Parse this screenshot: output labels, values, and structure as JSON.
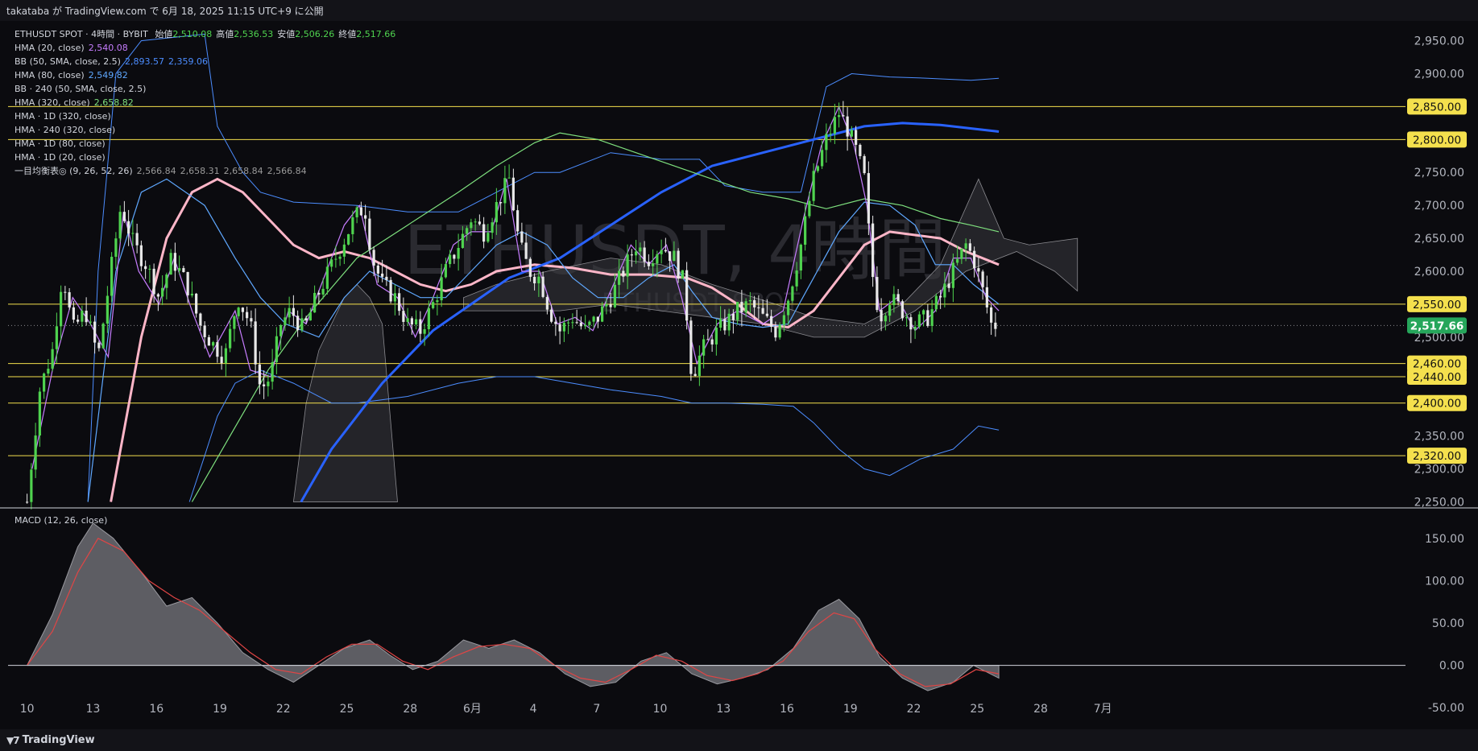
{
  "header": {
    "publish_text": "takataba が TradingView.com で 6月 18, 2025 11:15 UTC+9 に公開"
  },
  "watermark": {
    "main": "ETHUSDT, 4時間",
    "sub": "ETHUSDT SPOT"
  },
  "legend": {
    "symbol": "ETHUSDT SPOT · 4時間 · BYBIT",
    "ohlc": [
      {
        "label": "始値",
        "value": "2,510.08"
      },
      {
        "label": "高値",
        "value": "2,536.53"
      },
      {
        "label": "安値",
        "value": "2,506.26"
      },
      {
        "label": "終値",
        "value": "2,517.66"
      }
    ],
    "indicators": [
      {
        "name": "HMA (20, close)",
        "values": [
          "2,540.08"
        ],
        "color": "#c77dff"
      },
      {
        "name": "BB (50, SMA, close, 2.5)",
        "values": [
          "2,893.57",
          "2,359.06"
        ],
        "color": "#4c8dff"
      },
      {
        "name": "HMA (80, close)",
        "values": [
          "2,549.82"
        ],
        "color": "#5fa8ff"
      },
      {
        "name": "BB · 240 (50, SMA, close, 2.5)",
        "values": [],
        "color": "#d1d4dc"
      },
      {
        "name": "HMA (320, close)",
        "values": [
          "2,658.82"
        ],
        "color": "#7ee07e"
      },
      {
        "name": "HMA · 1D (320, close)",
        "values": [],
        "color": "#d1d4dc"
      },
      {
        "name": "HMA · 240 (320, close)",
        "values": [],
        "color": "#d1d4dc"
      },
      {
        "name": "HMA · 1D (80, close)",
        "values": [],
        "color": "#d1d4dc"
      },
      {
        "name": "HMA · 1D (20, close)",
        "values": [],
        "color": "#d1d4dc"
      },
      {
        "name": "一目均衡表◎ (9, 26, 52, 26)",
        "values": [
          "2,566.84",
          "2,658.31",
          "2,658.84",
          "2,566.84"
        ],
        "color": "#9a9a9a"
      }
    ]
  },
  "macd_label": "MACD (12, 26, close)",
  "footer": {
    "brand": "TradingView"
  },
  "colors": {
    "up": "#4fd34f",
    "down": "#e8e8e8",
    "hma20": "#c77dff",
    "hma80": "#5fa8ff",
    "hma320": "#7ee07e",
    "pink": "#ffb6c8",
    "blue": "#2962ff",
    "bb": "#4c8dff",
    "level": "#f4e04d",
    "level_bg": "#f4e04d",
    "last": "#26a65b"
  },
  "chart_data": [
    {
      "type": "candlestick",
      "title": "ETHUSDT SPOT · 4時間 · BYBIT",
      "y_ticks": [
        2250,
        2300,
        2350,
        2400,
        2450,
        2500,
        2550,
        2600,
        2650,
        2700,
        2750,
        2800,
        2850,
        2900,
        2950
      ],
      "ylim": [
        2242,
        2980
      ],
      "x_tick_labels": [
        "10",
        "13",
        "16",
        "19",
        "22",
        "25",
        "28",
        "6月",
        "4",
        "7",
        "10",
        "13",
        "16",
        "19",
        "22",
        "25",
        "28",
        "7月"
      ],
      "horizontal_levels": [
        {
          "value": 2850,
          "label": "2,850.00"
        },
        {
          "value": 2800,
          "label": "2,800.00"
        },
        {
          "value": 2550,
          "label": "2,550.00"
        },
        {
          "value": 2460,
          "label": "2,460.00"
        },
        {
          "value": 2440,
          "label": "2,440.00"
        },
        {
          "value": 2400,
          "label": "2,400.00"
        },
        {
          "value": 2320,
          "label": "2,320.00"
        }
      ],
      "last_price": {
        "value": 2517.66,
        "label": "2,517.66"
      },
      "close_path": [
        [
          10,
          2250
        ],
        [
          10.5,
          2420
        ],
        [
          11,
          2480
        ],
        [
          11.4,
          2600
        ],
        [
          11.8,
          2510
        ],
        [
          12.3,
          2540
        ],
        [
          12.8,
          2470
        ],
        [
          13.3,
          2600
        ],
        [
          13.7,
          2700
        ],
        [
          14.2,
          2640
        ],
        [
          14.7,
          2610
        ],
        [
          15.2,
          2560
        ],
        [
          15.7,
          2620
        ],
        [
          16.3,
          2580
        ],
        [
          16.8,
          2520
        ],
        [
          17.3,
          2490
        ],
        [
          17.8,
          2470
        ],
        [
          18.3,
          2560
        ],
        [
          18.8,
          2520
        ],
        [
          19.2,
          2420
        ],
        [
          19.6,
          2440
        ],
        [
          20.0,
          2520
        ],
        [
          20.4,
          2540
        ],
        [
          20.9,
          2510
        ],
        [
          21.4,
          2560
        ],
        [
          21.9,
          2600
        ],
        [
          22.4,
          2640
        ],
        [
          22.9,
          2680
        ],
        [
          23.3,
          2700
        ],
        [
          23.6,
          2620
        ],
        [
          24.0,
          2580
        ],
        [
          24.5,
          2560
        ],
        [
          25.0,
          2520
        ],
        [
          25.5,
          2510
        ],
        [
          26.0,
          2550
        ],
        [
          26.5,
          2600
        ],
        [
          27.0,
          2640
        ],
        [
          27.5,
          2680
        ],
        [
          28.0,
          2660
        ],
        [
          28.5,
          2700
        ],
        [
          29.0,
          2740
        ],
        [
          29.4,
          2640
        ],
        [
          29.8,
          2600
        ],
        [
          30.2,
          2590
        ],
        [
          30.6,
          2540
        ],
        [
          31.0,
          2510
        ],
        [
          31.5,
          2530
        ],
        [
          32.0,
          2510
        ],
        [
          32.5,
          2530
        ],
        [
          33.0,
          2560
        ],
        [
          33.5,
          2600
        ],
        [
          34.0,
          2640
        ],
        [
          34.5,
          2620
        ],
        [
          35.0,
          2640
        ],
        [
          35.5,
          2620
        ],
        [
          35.9,
          2580
        ],
        [
          36.2,
          2440
        ],
        [
          36.6,
          2480
        ],
        [
          37.0,
          2500
        ],
        [
          37.5,
          2520
        ],
        [
          38.0,
          2540
        ],
        [
          38.5,
          2550
        ],
        [
          39.0,
          2530
        ],
        [
          39.5,
          2510
        ],
        [
          40.0,
          2560
        ],
        [
          40.5,
          2640
        ],
        [
          41.0,
          2740
        ],
        [
          41.5,
          2800
        ],
        [
          42.0,
          2840
        ],
        [
          42.3,
          2820
        ],
        [
          42.7,
          2780
        ],
        [
          43.0,
          2740
        ],
        [
          43.3,
          2600
        ],
        [
          43.6,
          2530
        ],
        [
          44.0,
          2560
        ],
        [
          44.5,
          2540
        ],
        [
          45.0,
          2520
        ],
        [
          45.5,
          2530
        ],
        [
          46.0,
          2560
        ],
        [
          46.5,
          2600
        ],
        [
          47.0,
          2640
        ],
        [
          47.3,
          2620
        ],
        [
          47.6,
          2580
        ],
        [
          48.0,
          2520
        ],
        [
          48.3,
          2517.66
        ]
      ]
    },
    {
      "type": "area",
      "title": "MACD (12, 26, close)",
      "y_ticks": [
        -50,
        0,
        50,
        100,
        150
      ],
      "ylim": [
        -66,
        185
      ],
      "macd": [
        [
          10,
          0
        ],
        [
          11,
          60
        ],
        [
          12,
          140
        ],
        [
          12.6,
          168
        ],
        [
          13.4,
          150
        ],
        [
          14.5,
          110
        ],
        [
          15.5,
          70
        ],
        [
          16.5,
          80
        ],
        [
          17.5,
          50
        ],
        [
          18.5,
          15
        ],
        [
          19.5,
          -5
        ],
        [
          20.5,
          -20
        ],
        [
          21.5,
          0
        ],
        [
          22.5,
          20
        ],
        [
          23.5,
          30
        ],
        [
          24.3,
          12
        ],
        [
          25.2,
          -5
        ],
        [
          26.2,
          5
        ],
        [
          27.2,
          30
        ],
        [
          28.2,
          20
        ],
        [
          29.2,
          30
        ],
        [
          30.2,
          15
        ],
        [
          31.2,
          -10
        ],
        [
          32.2,
          -25
        ],
        [
          33.2,
          -20
        ],
        [
          34.2,
          5
        ],
        [
          35.2,
          15
        ],
        [
          36.2,
          -10
        ],
        [
          37.2,
          -22
        ],
        [
          38.2,
          -15
        ],
        [
          39.2,
          -5
        ],
        [
          40.2,
          20
        ],
        [
          41.2,
          65
        ],
        [
          42.0,
          78
        ],
        [
          42.8,
          55
        ],
        [
          43.6,
          10
        ],
        [
          44.5,
          -15
        ],
        [
          45.5,
          -30
        ],
        [
          46.5,
          -20
        ],
        [
          47.3,
          0
        ],
        [
          48.3,
          -15
        ]
      ],
      "signal": [
        [
          10,
          0
        ],
        [
          11,
          40
        ],
        [
          12,
          110
        ],
        [
          12.8,
          150
        ],
        [
          13.8,
          135
        ],
        [
          14.8,
          100
        ],
        [
          15.8,
          80
        ],
        [
          16.8,
          65
        ],
        [
          17.8,
          40
        ],
        [
          18.8,
          15
        ],
        [
          19.8,
          -5
        ],
        [
          20.8,
          -10
        ],
        [
          21.8,
          10
        ],
        [
          22.8,
          25
        ],
        [
          23.8,
          25
        ],
        [
          24.8,
          5
        ],
        [
          25.8,
          -5
        ],
        [
          26.8,
          10
        ],
        [
          27.8,
          22
        ],
        [
          28.8,
          25
        ],
        [
          29.8,
          20
        ],
        [
          30.8,
          0
        ],
        [
          31.8,
          -15
        ],
        [
          32.8,
          -20
        ],
        [
          33.8,
          -5
        ],
        [
          34.8,
          12
        ],
        [
          35.8,
          5
        ],
        [
          36.8,
          -12
        ],
        [
          37.8,
          -18
        ],
        [
          38.8,
          -10
        ],
        [
          39.8,
          5
        ],
        [
          40.8,
          40
        ],
        [
          41.8,
          62
        ],
        [
          42.6,
          55
        ],
        [
          43.4,
          20
        ],
        [
          44.4,
          -10
        ],
        [
          45.4,
          -25
        ],
        [
          46.4,
          -22
        ],
        [
          47.4,
          -5
        ],
        [
          48.3,
          -10
        ]
      ]
    }
  ]
}
